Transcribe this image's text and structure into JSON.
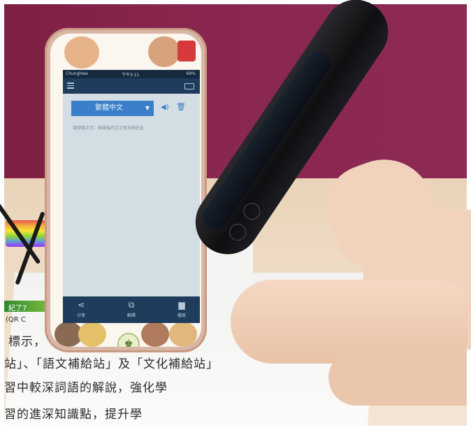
{
  "phone_screen": {
    "status": {
      "carrier": "Chunghwa",
      "time": "下午3:11",
      "battery": "69%"
    },
    "language_selector": {
      "value": "繁體中文",
      "icons": [
        "chevron-down-icon",
        "speaker-icon",
        "trash-icon"
      ]
    },
    "placeholder": "請掃描文字，掃描後的文字會出現在此",
    "tabs": [
      {
        "label": "分享",
        "icon": "share-icon"
      },
      {
        "label": "翻譯",
        "icon": "translate-icon"
      },
      {
        "label": "檔案",
        "icon": "folder-icon"
      }
    ]
  },
  "document_text": {
    "line1": "標示，",
    "line2": "站」、「語文補給站」及「文化補給站」",
    "line3": "習中較深詞語的解說，強化學",
    "line4": "習的進深知識點，提升學",
    "small1": "(QR C",
    "small2": "紀了7"
  },
  "colors": {
    "wall": "#8a2750",
    "app_bar": "#1f3c5c",
    "accent": "#3a80c9"
  }
}
